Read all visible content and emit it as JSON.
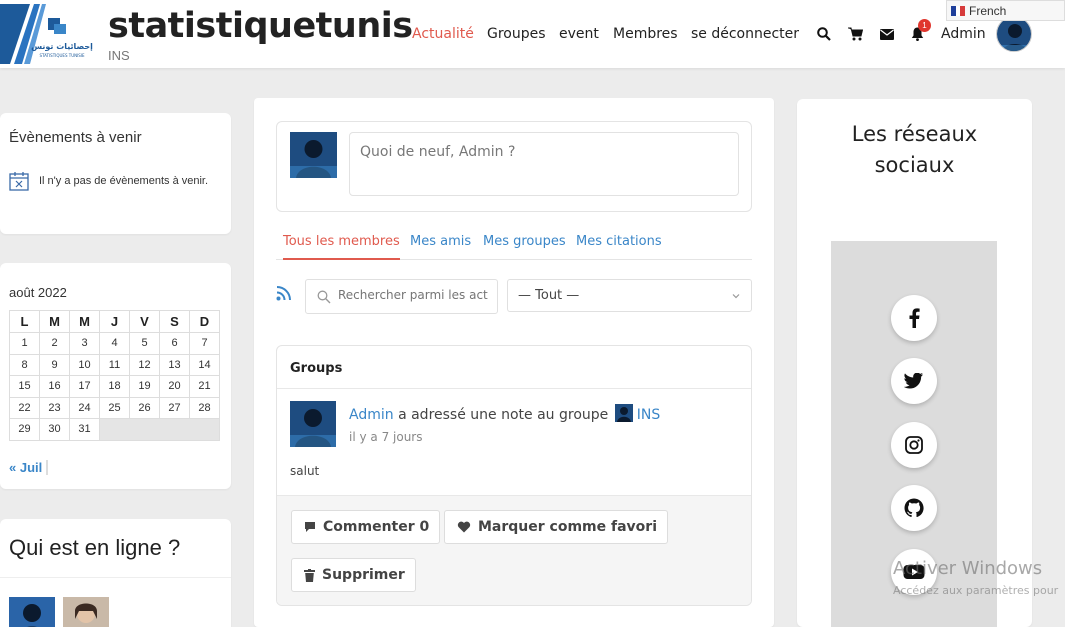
{
  "header": {
    "site_title": "statistiquetunis",
    "site_subtitle": "INS",
    "logo_text": "إحصائيات تونس",
    "logo_subtext": "STATISTIQUES TUNISIE",
    "nav": [
      "Actualité",
      "Groupes",
      "event",
      "Membres",
      "se déconnecter"
    ],
    "active_nav": "Actualité",
    "notification_count": "1",
    "user_name": "Admin",
    "language": "French",
    "icons": [
      "search-icon",
      "cart-icon",
      "mail-icon",
      "bell-icon"
    ]
  },
  "events_widget": {
    "title": "Évènements à venir",
    "empty_text": "Il n'y a pas de évènements à venir."
  },
  "calendar": {
    "month": "août 2022",
    "weekdays": [
      "L",
      "M",
      "M",
      "J",
      "V",
      "S",
      "D"
    ],
    "weeks": [
      [
        "1",
        "2",
        "3",
        "4",
        "5",
        "6",
        "7"
      ],
      [
        "8",
        "9",
        "10",
        "11",
        "12",
        "13",
        "14"
      ],
      [
        "15",
        "16",
        "17",
        "18",
        "19",
        "20",
        "21"
      ],
      [
        "22",
        "23",
        "24",
        "25",
        "26",
        "27",
        "28"
      ],
      [
        "29",
        "30",
        "31",
        "",
        "",
        "",
        ""
      ]
    ],
    "prev_link": "« Juil"
  },
  "online_widget": {
    "title": "Qui est en ligne ?"
  },
  "post_form": {
    "placeholder": "Quoi de neuf, Admin ?"
  },
  "tabs": [
    "Tous les membres",
    "Mes amis",
    "Mes groupes",
    "Mes citations"
  ],
  "active_tab": "Tous les membres",
  "search": {
    "placeholder": "Rechercher parmi les activités..."
  },
  "filter": {
    "selected": "— Tout —"
  },
  "activity": {
    "section_title": "Groups",
    "author": "Admin",
    "action_text": "a adressé une note au groupe",
    "group": "INS",
    "time": "il y a 7 jours",
    "content": "salut",
    "buttons": {
      "comment": "Commenter 0",
      "favorite": "Marquer comme favori",
      "delete": "Supprimer"
    }
  },
  "social": {
    "title_line1": "Les réseaux",
    "title_line2": "sociaux",
    "icons": [
      "facebook-icon",
      "twitter-icon",
      "instagram-icon",
      "github-icon",
      "youtube-icon"
    ]
  },
  "watermark": {
    "line1": "Activer Windows",
    "line2": "Accédez aux paramètres pour"
  },
  "colors": {
    "accent": "#e05a4e",
    "link": "#3a86c8",
    "background": "#ececec"
  }
}
